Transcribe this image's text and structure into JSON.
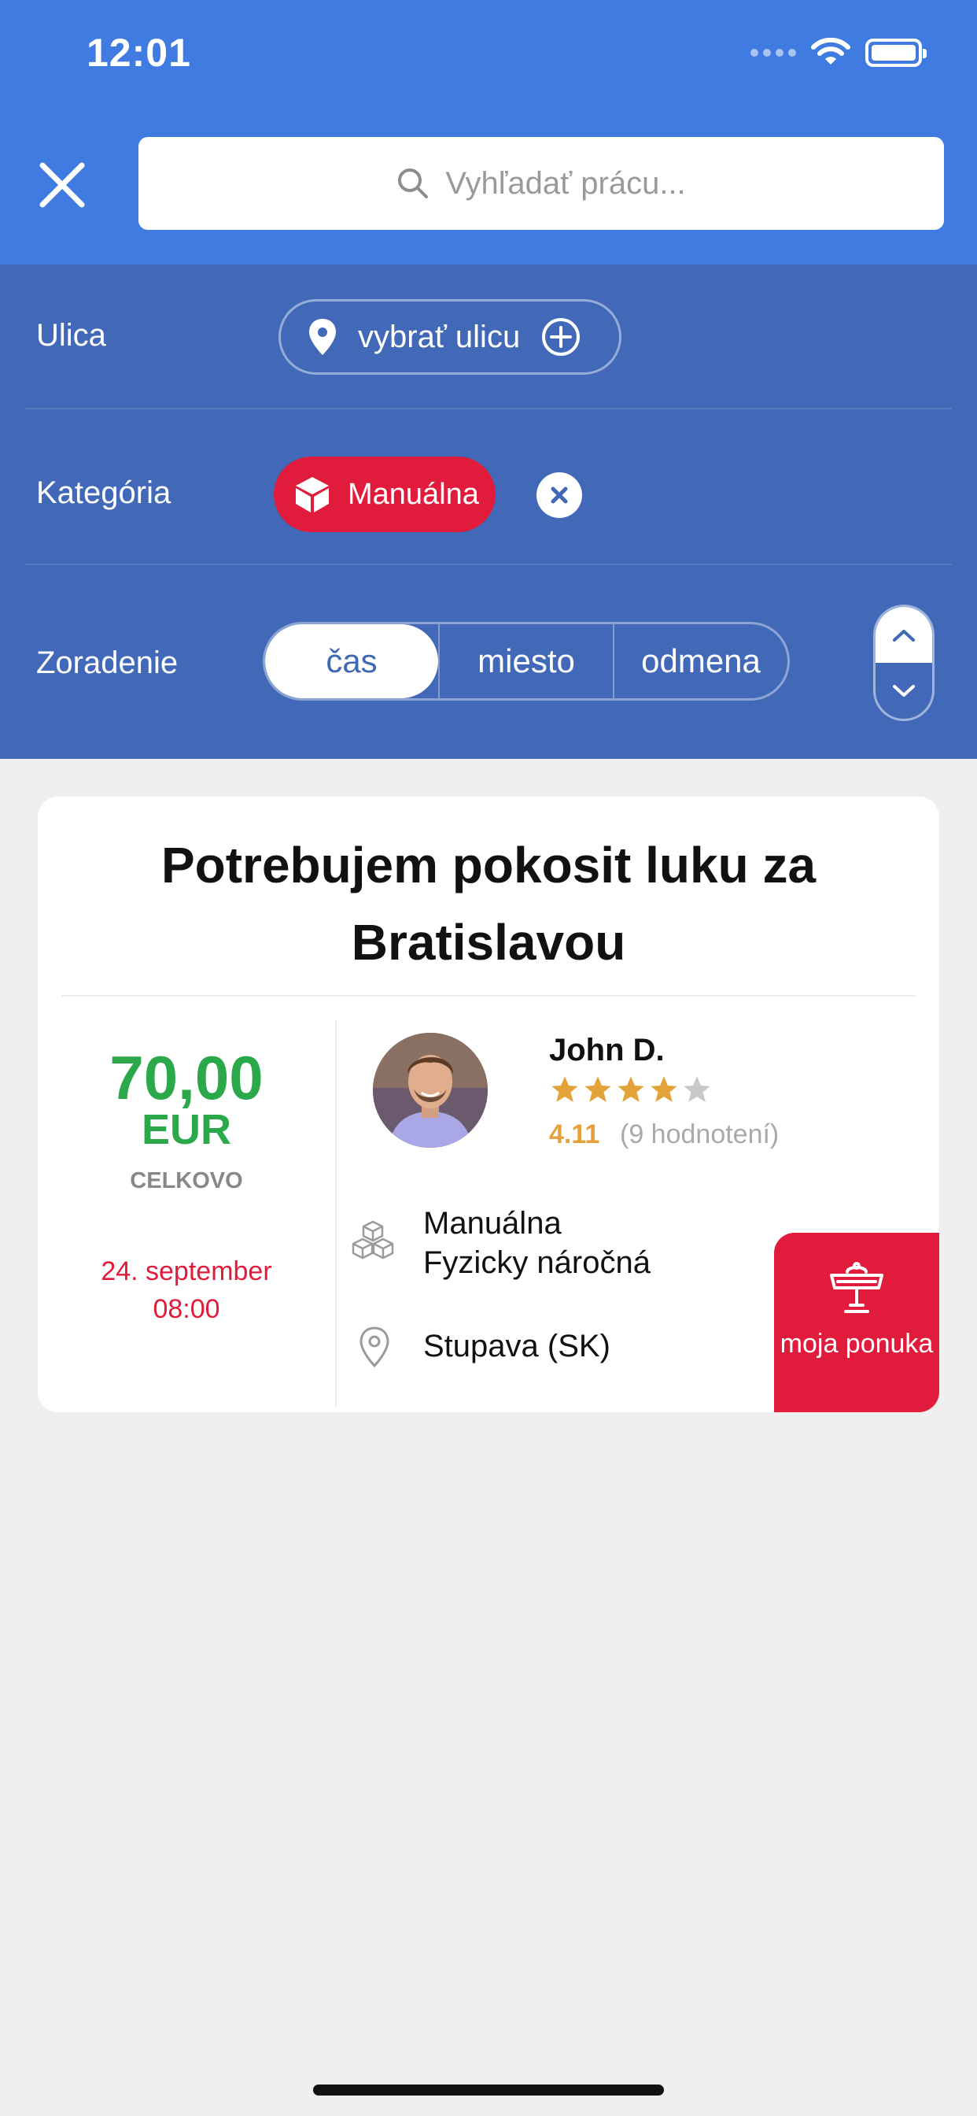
{
  "status_bar": {
    "time": "12:01"
  },
  "search": {
    "placeholder": "Vyhľadať prácu..."
  },
  "filters": {
    "street": {
      "label": "Ulica",
      "value": "vybrať ulicu"
    },
    "category": {
      "label": "Kategória",
      "value": "Manuálna"
    },
    "sort": {
      "label": "Zoradenie",
      "options": [
        "čas",
        "miesto",
        "odmena"
      ],
      "selected": "čas",
      "direction": "ascending"
    }
  },
  "job": {
    "title": "Potrebujem pokosit luku za Bratislavou",
    "price": "70,00",
    "currency": "EUR",
    "total_label": "CELKOVO",
    "date": "24. september",
    "time": "08:00",
    "user": {
      "name": "John D.",
      "rating": "4.11",
      "rating_count": "(9 hodnotení)",
      "stars_filled": 4,
      "stars_total": 5
    },
    "category_primary": "Manuálna",
    "category_secondary": "Fyzicky náročná",
    "location": "Stupava (SK)",
    "offer_label": "moja ponuka"
  },
  "colors": {
    "header_blue": "#3f7be0",
    "filter_blue": "#4169b8",
    "accent_red": "#e11b3b",
    "price_green": "#2aa84a",
    "star_orange": "#e4a33a"
  },
  "icons": [
    "close-icon",
    "search-icon",
    "location-pin-icon",
    "plus-circle-icon",
    "cube-icon",
    "clear-icon",
    "chevron-up-icon",
    "chevron-down-icon",
    "star-icon",
    "cubes-icon",
    "map-pin-icon",
    "auction-icon"
  ]
}
